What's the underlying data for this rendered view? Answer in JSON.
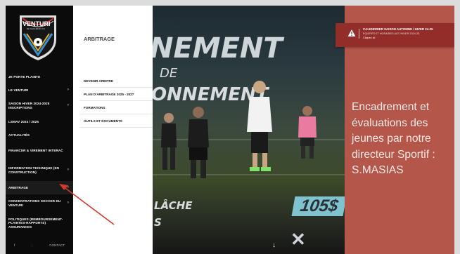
{
  "brand": {
    "name": "VENTURI",
    "sub": "DE SAGUENAY FC"
  },
  "sidebar": {
    "items": [
      {
        "label": "JE PORTE PLAINTE",
        "chevron": false
      },
      {
        "label": "LE VENTURI",
        "chevron": true
      },
      {
        "label": "SAISON HIVER 2024-2025 INSCRIPTIONS",
        "chevron": true
      },
      {
        "label": "LSMAV 2024 / 2025",
        "chevron": false
      },
      {
        "label": "ACTUALITÉS",
        "chevron": false
      },
      {
        "label": "FINANCER & VIREMENT INTERAC",
        "chevron": false
      },
      {
        "label": "INFORMATION TECHNIQUE (EN CONSTRUCTION)",
        "chevron": true
      },
      {
        "label": "ARBITRAGE",
        "chevron": true
      },
      {
        "label": "CONCENTRATIONS SOCCER DU VENTURI",
        "chevron": true
      },
      {
        "label": "POLITIQUES (REMBOURSEMENT-PLAINTES-RAPPORTS) ASSURANCES",
        "chevron": false
      }
    ],
    "footer": {
      "f_icon": "f",
      "contact": "CONTACT"
    }
  },
  "submenu": {
    "title": "ARBITRAGE",
    "items": [
      {
        "label": "DEVENIR ARBITRE"
      },
      {
        "label": "PLAN D'ARBITRAGE 2025 - 2027"
      },
      {
        "label": "FORMATIONS"
      },
      {
        "label": "OUTILS ET DOCUMENTS"
      }
    ]
  },
  "hero": {
    "line1": "NEMENT",
    "line2": "DE",
    "line3": "ONNEMENT",
    "bottom1": "LÂCHE",
    "bottom2": "S",
    "price": "105$"
  },
  "banner": {
    "title": "CALENDRIER SAISON AUTOMNE / HIVER 24-25",
    "subtitle": "EQUIPES ET HORAIRES AUT./HIVER 2024-25",
    "link": "Cliquez ici"
  },
  "info": {
    "text": "Encadrement et évaluations des jeunes par notre directeur Sportif : S.MASIAS"
  },
  "colors": {
    "sidebar": "#0b0b0b",
    "info_panel": "#b4574a",
    "banner": "#922d2a",
    "annotation_arrow": "#d33a2c"
  },
  "icons": [
    "warning-icon",
    "chevron-right-icon",
    "facebook-icon",
    "down-arrow-icon",
    "close-icon"
  ]
}
